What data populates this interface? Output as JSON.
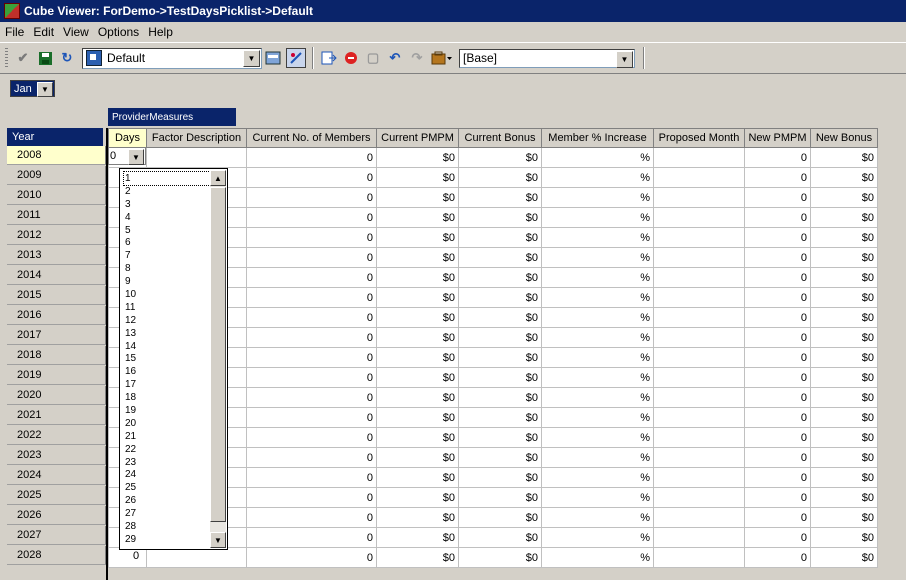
{
  "window": {
    "title": "Cube Viewer: ForDemo->TestDaysPicklist->Default"
  },
  "menu": [
    {
      "label": "File"
    },
    {
      "label": "Edit"
    },
    {
      "label": "View"
    },
    {
      "label": "Options"
    },
    {
      "label": "Help"
    }
  ],
  "toolbar": {
    "view_combo": "Default",
    "subset_combo": "[Base]"
  },
  "title_dimension": {
    "value": "Jan"
  },
  "grid": {
    "column_dimension": "ProviderMeasures",
    "row_dimension": "Year",
    "columns": [
      "Days",
      "Factor Description",
      "Current No. of Members",
      "Current PMPM",
      "Current Bonus",
      "Member % Increase",
      "Proposed Month",
      "New PMPM",
      "New Bonus"
    ],
    "rows": [
      "2008",
      "2009",
      "2010",
      "2011",
      "2012",
      "2013",
      "2014",
      "2015",
      "2016",
      "2017",
      "2018",
      "2019",
      "2020",
      "2021",
      "2022",
      "2023",
      "2024",
      "2025",
      "2026",
      "2027",
      "2028"
    ],
    "row_values": {
      "members": "0",
      "pmpm": "$0",
      "bonus": "$0",
      "increase": "%",
      "month": "",
      "new_pmpm": "0",
      "new_bonus": "$0"
    },
    "active_cell_value": "0",
    "last_row_days": "0"
  },
  "picklist": {
    "items": [
      "1",
      "2",
      "3",
      "4",
      "5",
      "6",
      "7",
      "8",
      "9",
      "10",
      "11",
      "12",
      "13",
      "14",
      "15",
      "16",
      "17",
      "18",
      "19",
      "20",
      "21",
      "22",
      "23",
      "24",
      "25",
      "26",
      "27",
      "28",
      "29"
    ],
    "selected": "1"
  },
  "colors": {
    "title_bar": "#0a246a",
    "header_highlight": "#ffffcc",
    "chrome": "#d4d0c8"
  }
}
